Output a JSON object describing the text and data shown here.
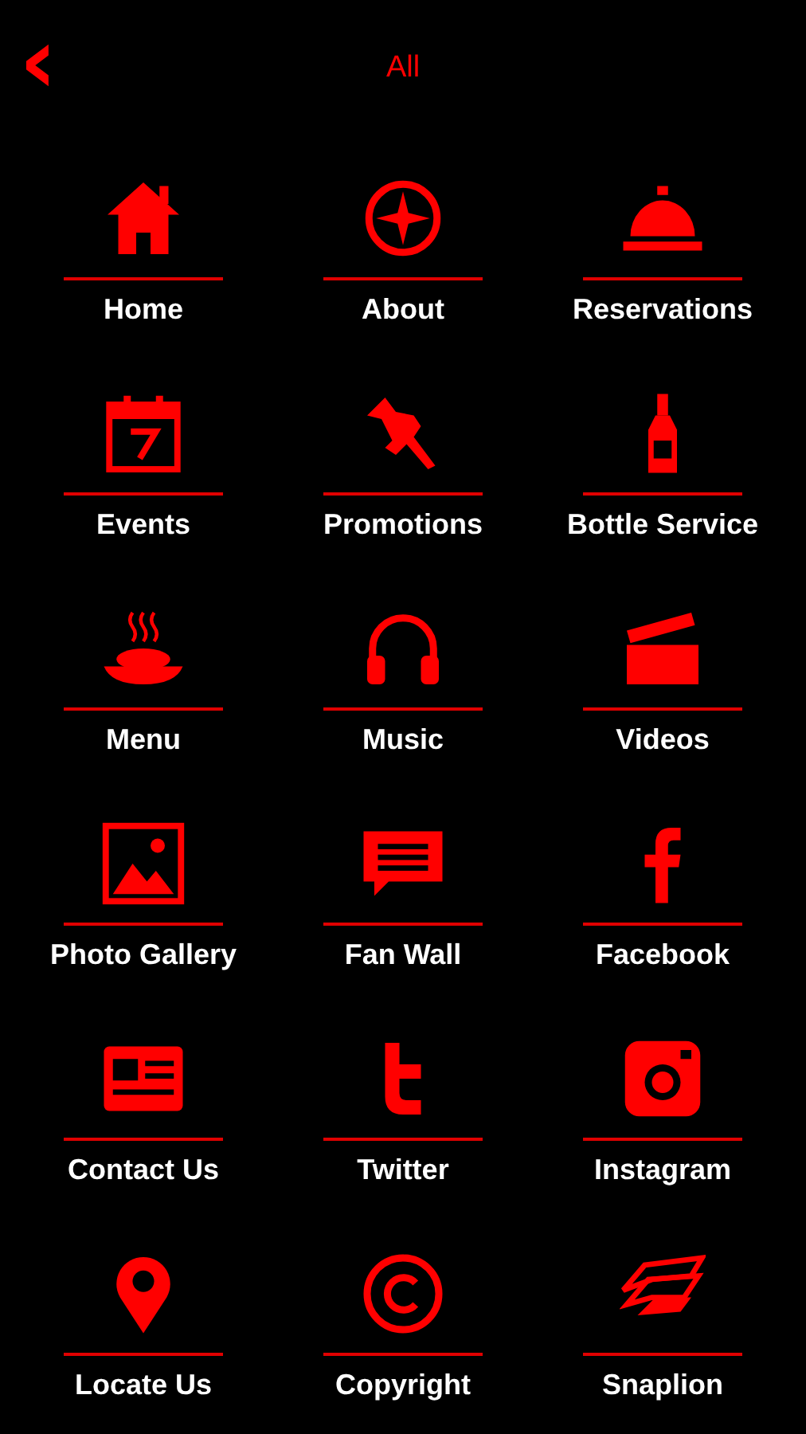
{
  "header": {
    "back": "‹",
    "title": "All"
  },
  "items": [
    {
      "label": "Home"
    },
    {
      "label": "About"
    },
    {
      "label": "Reservations"
    },
    {
      "label": "Events"
    },
    {
      "label": "Promotions"
    },
    {
      "label": "Bottle Service"
    },
    {
      "label": "Menu"
    },
    {
      "label": "Music"
    },
    {
      "label": "Videos"
    },
    {
      "label": "Photo Gallery"
    },
    {
      "label": "Fan Wall"
    },
    {
      "label": "Facebook"
    },
    {
      "label": "Contact Us"
    },
    {
      "label": "Twitter"
    },
    {
      "label": "Instagram"
    },
    {
      "label": "Locate Us"
    },
    {
      "label": "Copyright"
    },
    {
      "label": "Snaplion"
    }
  ]
}
